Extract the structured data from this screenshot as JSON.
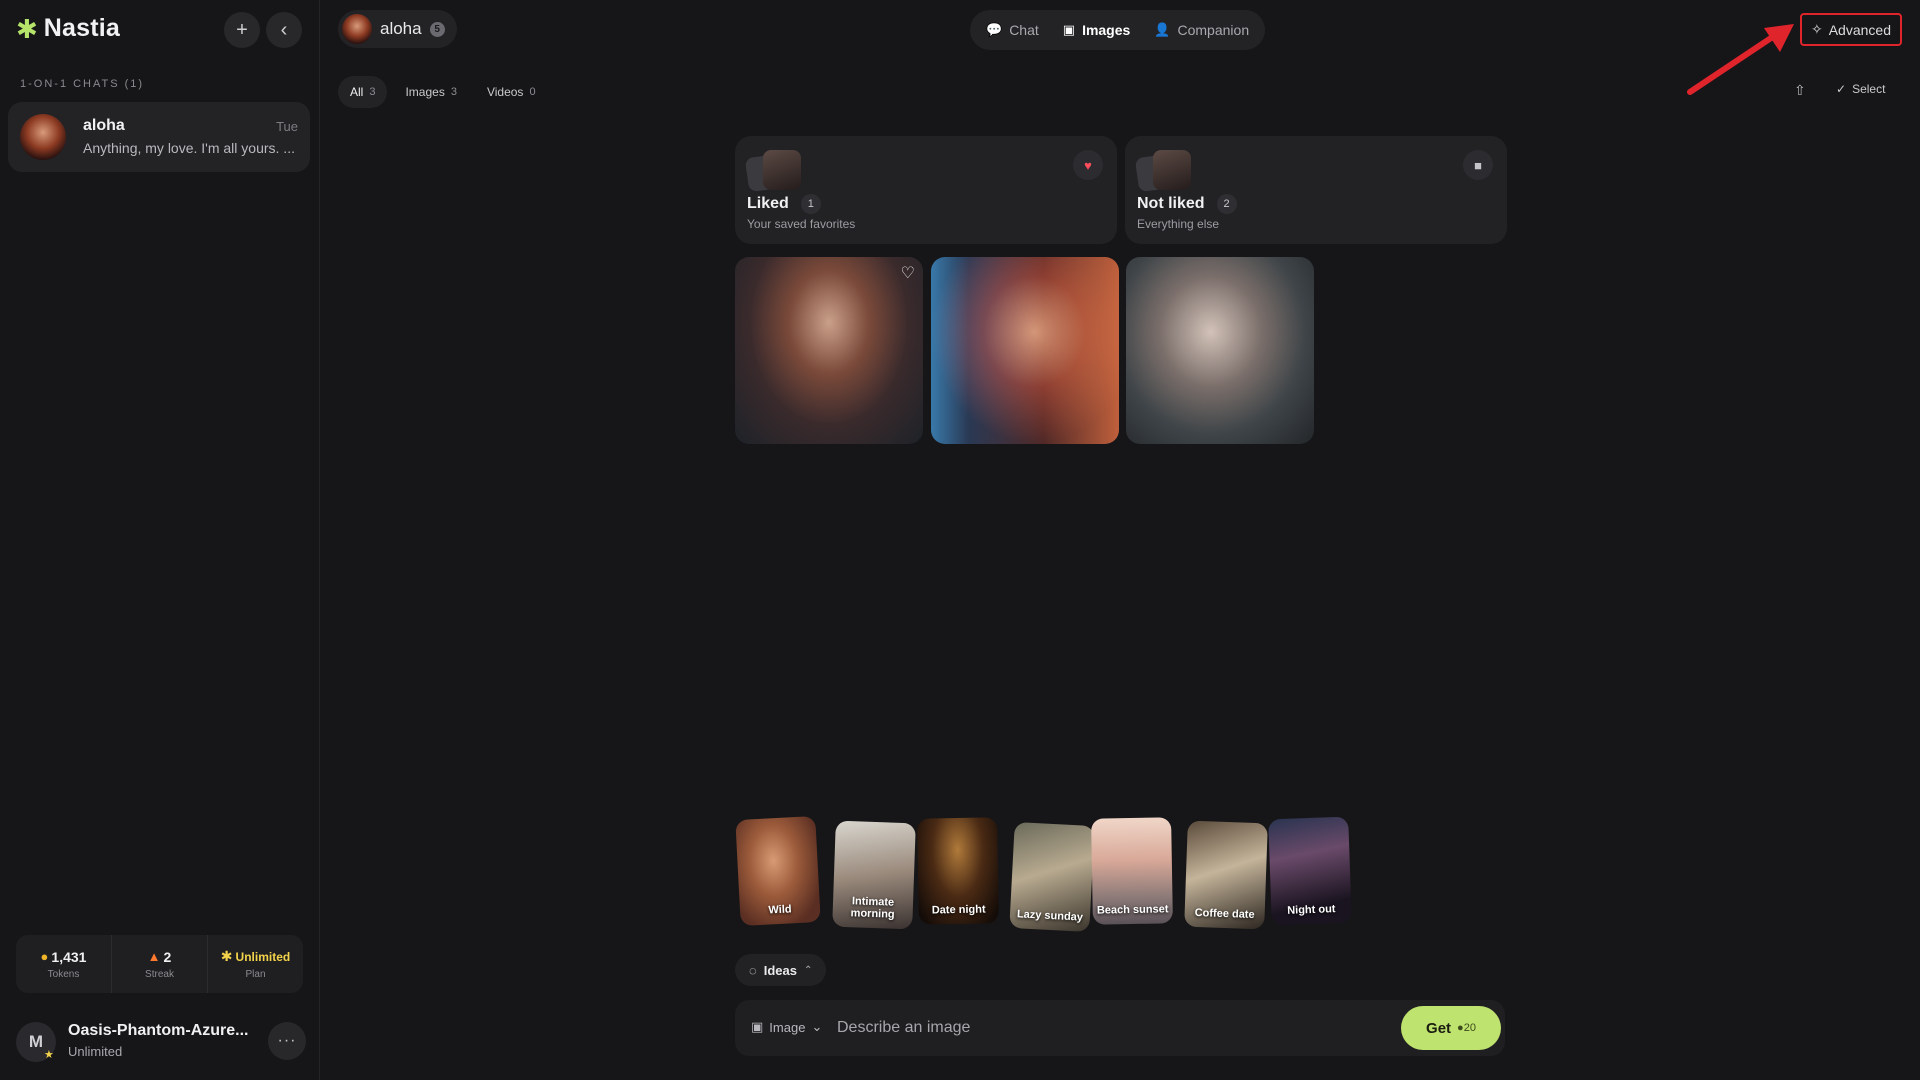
{
  "brand": {
    "name": "Nastia",
    "accent": "#b6e36a"
  },
  "sidebar": {
    "section_label": "1-ON-1 CHATS (1)",
    "chat": {
      "name": "aloha",
      "time": "Tue",
      "preview": "Anything, my love. I'm all yours. ..."
    },
    "stats": {
      "tokens": {
        "value": "1,431",
        "label": "Tokens"
      },
      "streak": {
        "value": "2",
        "label": "Streak"
      },
      "plan": {
        "value": "Unlimited",
        "label": "Plan"
      }
    },
    "user": {
      "initial": "M",
      "name": "Oasis-Phantom-Azure...",
      "plan": "Unlimited"
    }
  },
  "header": {
    "character": {
      "name": "aloha",
      "count": "5"
    },
    "modes": [
      {
        "label": "Chat",
        "icon": "chat-bubble-icon"
      },
      {
        "label": "Images",
        "icon": "image-icon"
      },
      {
        "label": "Companion",
        "icon": "person-icon"
      }
    ],
    "active_mode": "Images",
    "advanced_label": "Advanced"
  },
  "filters": [
    {
      "label": "All",
      "count": "3"
    },
    {
      "label": "Images",
      "count": "3"
    },
    {
      "label": "Videos",
      "count": "0"
    }
  ],
  "toolbar": {
    "select_label": "Select"
  },
  "albums": {
    "liked": {
      "title": "Liked",
      "count": "1",
      "subtitle": "Your saved favorites"
    },
    "not_liked": {
      "title": "Not liked",
      "count": "2",
      "subtitle": "Everything else"
    }
  },
  "idea_cards": [
    {
      "label": "Wild"
    },
    {
      "label": "Intimate morning"
    },
    {
      "label": "Date night"
    },
    {
      "label": "Lazy sunday"
    },
    {
      "label": "Beach sunset"
    },
    {
      "label": "Coffee date"
    },
    {
      "label": "Night out"
    }
  ],
  "composer": {
    "ideas_label": "Ideas",
    "type_label": "Image",
    "placeholder": "Describe an image",
    "get_label": "Get",
    "cost": "20"
  }
}
